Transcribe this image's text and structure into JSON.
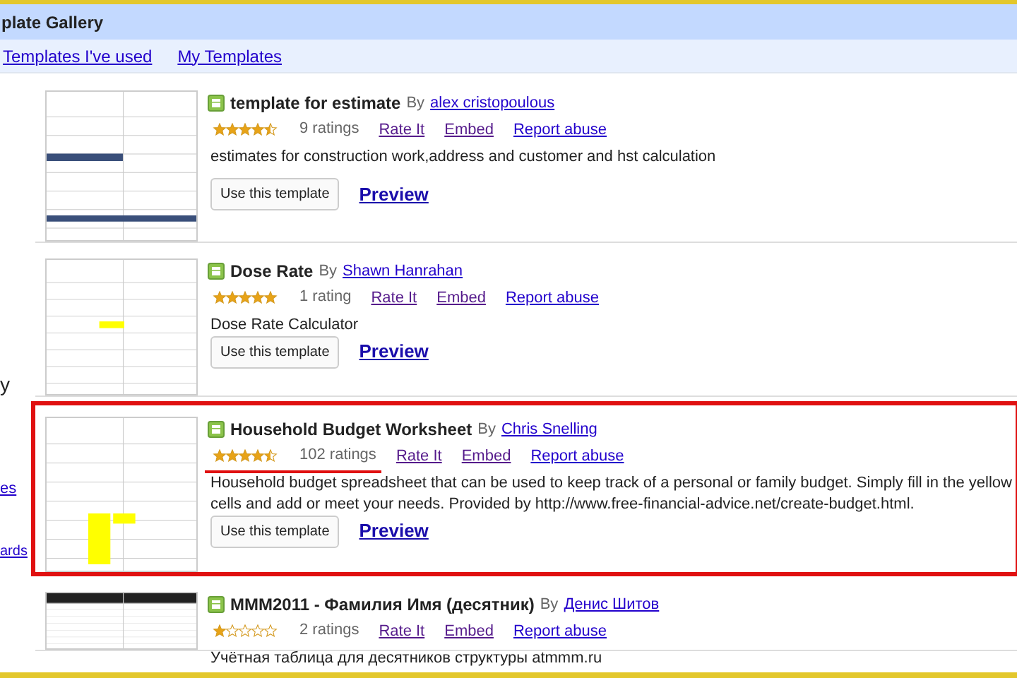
{
  "header": {
    "title": "plate Gallery"
  },
  "tabs": [
    {
      "label": "Templates I've used",
      "selected": false
    },
    {
      "label": "My Templates",
      "selected": false
    }
  ],
  "sidebar": {
    "items": [
      {
        "label": "y",
        "kind": "text"
      },
      {
        "label": "es",
        "kind": "link"
      },
      {
        "label": "ards",
        "kind": "link"
      }
    ]
  },
  "templates": [
    {
      "title": "template for estimate",
      "by": "By",
      "author": "alex cristopoulous",
      "stars": 4.5,
      "ratings": "9 ratings",
      "rate": "Rate It",
      "embed": "Embed",
      "report": "Report abuse",
      "description": "estimates for construction work,address and customer and hst calculation",
      "use_button": "Use this template",
      "preview": "Preview",
      "highlighted": false
    },
    {
      "title": "Dose Rate",
      "by": "By",
      "author": "Shawn Hanrahan",
      "stars": 5,
      "ratings": "1 rating",
      "rate": "Rate It",
      "embed": "Embed",
      "report": "Report abuse",
      "description": "Dose Rate Calculator",
      "use_button": "Use this template",
      "preview": "Preview",
      "highlighted": false
    },
    {
      "title": "Household Budget Worksheet",
      "by": "By",
      "author": "Chris Snelling",
      "stars": 4.5,
      "ratings": "102 ratings",
      "rate": "Rate It",
      "embed": "Embed",
      "report": "Report abuse",
      "description": "Household budget spreadsheet that can be used to keep track of a personal or family budget. Simply fill in the yellow cells and add or meet your needs. Provided by http://www.free-financial-advice.net/create-budget.html.",
      "use_button": "Use this template",
      "preview": "Preview",
      "highlighted": true
    },
    {
      "title": "MMM2011 - Фамилия Имя (десятник)",
      "by": "By",
      "author": "Денис Шитов",
      "stars": 1,
      "ratings": "2 ratings",
      "rate": "Rate It",
      "embed": "Embed",
      "report": "Report abuse",
      "description": "Учётная таблица для десятников структуры atmmm.ru",
      "highlighted": false
    }
  ]
}
